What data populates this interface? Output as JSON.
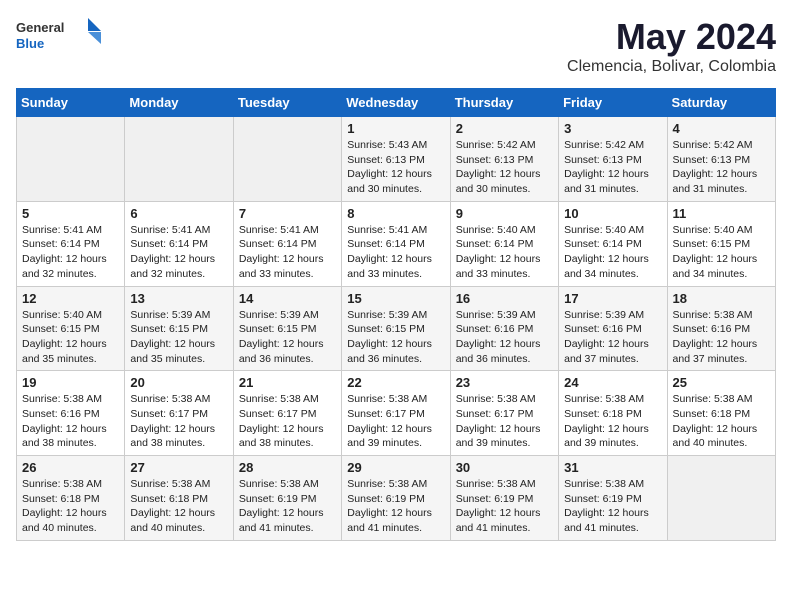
{
  "logo": {
    "general": "General",
    "blue": "Blue"
  },
  "title": "May 2024",
  "subtitle": "Clemencia, Bolivar, Colombia",
  "headers": [
    "Sunday",
    "Monday",
    "Tuesday",
    "Wednesday",
    "Thursday",
    "Friday",
    "Saturday"
  ],
  "weeks": [
    [
      {
        "day": "",
        "info": ""
      },
      {
        "day": "",
        "info": ""
      },
      {
        "day": "",
        "info": ""
      },
      {
        "day": "1",
        "info": "Sunrise: 5:43 AM\nSunset: 6:13 PM\nDaylight: 12 hours\nand 30 minutes."
      },
      {
        "day": "2",
        "info": "Sunrise: 5:42 AM\nSunset: 6:13 PM\nDaylight: 12 hours\nand 30 minutes."
      },
      {
        "day": "3",
        "info": "Sunrise: 5:42 AM\nSunset: 6:13 PM\nDaylight: 12 hours\nand 31 minutes."
      },
      {
        "day": "4",
        "info": "Sunrise: 5:42 AM\nSunset: 6:13 PM\nDaylight: 12 hours\nand 31 minutes."
      }
    ],
    [
      {
        "day": "5",
        "info": "Sunrise: 5:41 AM\nSunset: 6:14 PM\nDaylight: 12 hours\nand 32 minutes."
      },
      {
        "day": "6",
        "info": "Sunrise: 5:41 AM\nSunset: 6:14 PM\nDaylight: 12 hours\nand 32 minutes."
      },
      {
        "day": "7",
        "info": "Sunrise: 5:41 AM\nSunset: 6:14 PM\nDaylight: 12 hours\nand 33 minutes."
      },
      {
        "day": "8",
        "info": "Sunrise: 5:41 AM\nSunset: 6:14 PM\nDaylight: 12 hours\nand 33 minutes."
      },
      {
        "day": "9",
        "info": "Sunrise: 5:40 AM\nSunset: 6:14 PM\nDaylight: 12 hours\nand 33 minutes."
      },
      {
        "day": "10",
        "info": "Sunrise: 5:40 AM\nSunset: 6:14 PM\nDaylight: 12 hours\nand 34 minutes."
      },
      {
        "day": "11",
        "info": "Sunrise: 5:40 AM\nSunset: 6:15 PM\nDaylight: 12 hours\nand 34 minutes."
      }
    ],
    [
      {
        "day": "12",
        "info": "Sunrise: 5:40 AM\nSunset: 6:15 PM\nDaylight: 12 hours\nand 35 minutes."
      },
      {
        "day": "13",
        "info": "Sunrise: 5:39 AM\nSunset: 6:15 PM\nDaylight: 12 hours\nand 35 minutes."
      },
      {
        "day": "14",
        "info": "Sunrise: 5:39 AM\nSunset: 6:15 PM\nDaylight: 12 hours\nand 36 minutes."
      },
      {
        "day": "15",
        "info": "Sunrise: 5:39 AM\nSunset: 6:15 PM\nDaylight: 12 hours\nand 36 minutes."
      },
      {
        "day": "16",
        "info": "Sunrise: 5:39 AM\nSunset: 6:16 PM\nDaylight: 12 hours\nand 36 minutes."
      },
      {
        "day": "17",
        "info": "Sunrise: 5:39 AM\nSunset: 6:16 PM\nDaylight: 12 hours\nand 37 minutes."
      },
      {
        "day": "18",
        "info": "Sunrise: 5:38 AM\nSunset: 6:16 PM\nDaylight: 12 hours\nand 37 minutes."
      }
    ],
    [
      {
        "day": "19",
        "info": "Sunrise: 5:38 AM\nSunset: 6:16 PM\nDaylight: 12 hours\nand 38 minutes."
      },
      {
        "day": "20",
        "info": "Sunrise: 5:38 AM\nSunset: 6:17 PM\nDaylight: 12 hours\nand 38 minutes."
      },
      {
        "day": "21",
        "info": "Sunrise: 5:38 AM\nSunset: 6:17 PM\nDaylight: 12 hours\nand 38 minutes."
      },
      {
        "day": "22",
        "info": "Sunrise: 5:38 AM\nSunset: 6:17 PM\nDaylight: 12 hours\nand 39 minutes."
      },
      {
        "day": "23",
        "info": "Sunrise: 5:38 AM\nSunset: 6:17 PM\nDaylight: 12 hours\nand 39 minutes."
      },
      {
        "day": "24",
        "info": "Sunrise: 5:38 AM\nSunset: 6:18 PM\nDaylight: 12 hours\nand 39 minutes."
      },
      {
        "day": "25",
        "info": "Sunrise: 5:38 AM\nSunset: 6:18 PM\nDaylight: 12 hours\nand 40 minutes."
      }
    ],
    [
      {
        "day": "26",
        "info": "Sunrise: 5:38 AM\nSunset: 6:18 PM\nDaylight: 12 hours\nand 40 minutes."
      },
      {
        "day": "27",
        "info": "Sunrise: 5:38 AM\nSunset: 6:18 PM\nDaylight: 12 hours\nand 40 minutes."
      },
      {
        "day": "28",
        "info": "Sunrise: 5:38 AM\nSunset: 6:19 PM\nDaylight: 12 hours\nand 41 minutes."
      },
      {
        "day": "29",
        "info": "Sunrise: 5:38 AM\nSunset: 6:19 PM\nDaylight: 12 hours\nand 41 minutes."
      },
      {
        "day": "30",
        "info": "Sunrise: 5:38 AM\nSunset: 6:19 PM\nDaylight: 12 hours\nand 41 minutes."
      },
      {
        "day": "31",
        "info": "Sunrise: 5:38 AM\nSunset: 6:19 PM\nDaylight: 12 hours\nand 41 minutes."
      },
      {
        "day": "",
        "info": ""
      }
    ]
  ]
}
